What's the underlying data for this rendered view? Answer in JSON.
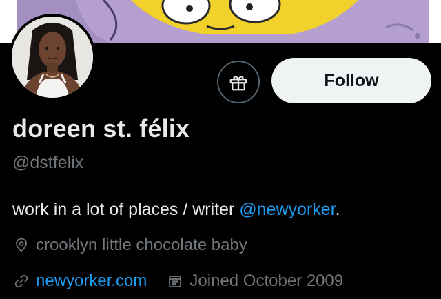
{
  "profile": {
    "display_name": "doreen st. félix",
    "handle": "@dstfelix",
    "bio_text": "work in a lot of places / writer ",
    "bio_mention": "@newyorker",
    "bio_end": ".",
    "location": "crooklyn little chocolate baby",
    "website": "newyorker.com",
    "joined": "Joined October 2009"
  },
  "actions": {
    "follow_label": "Follow"
  },
  "icons": {
    "gift": "gift-icon",
    "location": "location-pin-icon",
    "link": "link-icon",
    "calendar": "calendar-icon"
  },
  "colors": {
    "background": "#000000",
    "accent": "#1d9bf0",
    "muted": "#71767b",
    "follow_bg": "#eff3f4"
  }
}
